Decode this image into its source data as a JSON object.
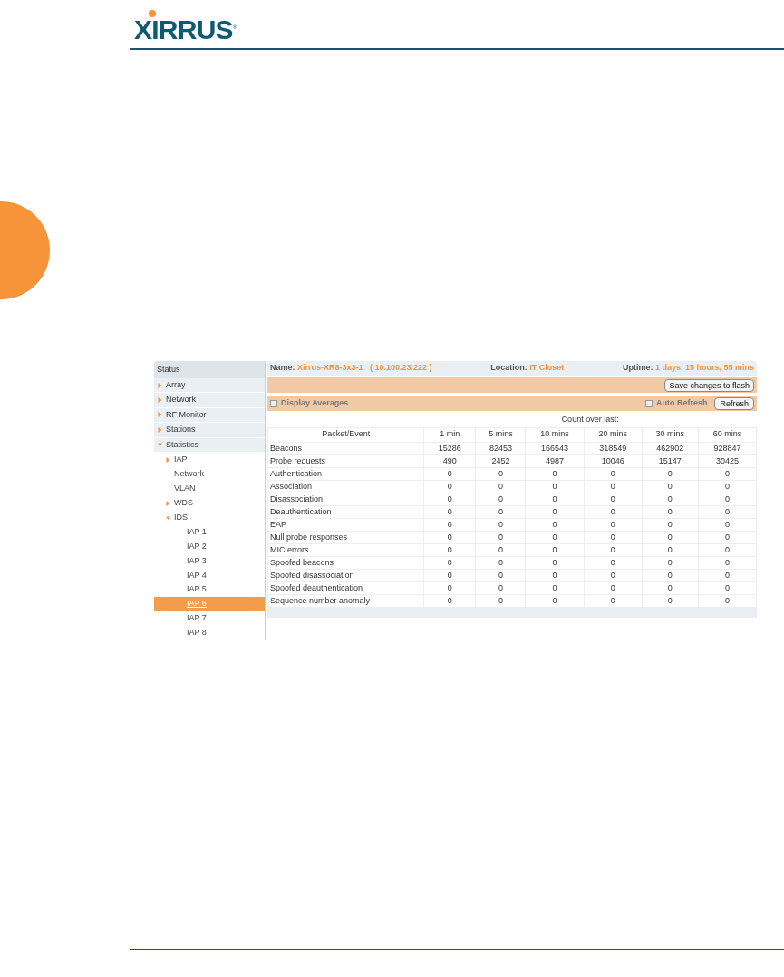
{
  "logo": {
    "text": "XIRRUS",
    "mark": "®"
  },
  "sidebar": {
    "header": "Status",
    "items": [
      {
        "label": "Array",
        "expanded": false,
        "selected": false
      },
      {
        "label": "Network",
        "expanded": false,
        "selected": false
      },
      {
        "label": "RF Monitor",
        "expanded": false,
        "selected": false
      },
      {
        "label": "Stations",
        "expanded": false,
        "selected": false
      },
      {
        "label": "Statistics",
        "expanded": true,
        "selected": false,
        "children": [
          {
            "label": "IAP",
            "expanded": false,
            "selected": false
          },
          {
            "label": "Network",
            "selected": false
          },
          {
            "label": "VLAN",
            "selected": false
          },
          {
            "label": "WDS",
            "expanded": false,
            "selected": false
          },
          {
            "label": "IDS",
            "expanded": true,
            "selected": false,
            "children": [
              {
                "label": "IAP 1",
                "selected": false
              },
              {
                "label": "IAP 2",
                "selected": false
              },
              {
                "label": "IAP 3",
                "selected": false
              },
              {
                "label": "IAP 4",
                "selected": false
              },
              {
                "label": "IAP 5",
                "selected": false
              },
              {
                "label": "IAP 6",
                "selected": true
              },
              {
                "label": "IAP 7",
                "selected": false
              },
              {
                "label": "IAP 8",
                "selected": false
              }
            ]
          }
        ]
      }
    ]
  },
  "info_bar": {
    "name_label": "Name:",
    "name_value": "Xirrus-XR8-3x3-1   ( 10.100.23.222 )",
    "location_label": "Location:",
    "location_value": "IT Closet",
    "uptime_label": "Uptime:",
    "uptime_value": "1 days, 15 hours, 55 mins"
  },
  "save_button": "Save changes to flash",
  "options": {
    "display_averages": {
      "label": "Display Averages",
      "checked": false
    },
    "auto_refresh": {
      "label": "Auto Refresh",
      "checked": false
    },
    "refresh_button": "Refresh"
  },
  "table": {
    "group_header": "Count over last:",
    "columns": [
      "Packet/Event",
      "1 min",
      "5 mins",
      "10 mins",
      "20 mins",
      "30 mins",
      "60 mins"
    ],
    "rows": [
      [
        "Beacons",
        "15286",
        "82453",
        "166543",
        "318549",
        "462902",
        "928847"
      ],
      [
        "Probe requests",
        "490",
        "2452",
        "4987",
        "10046",
        "15147",
        "30425"
      ],
      [
        "Authentication",
        "0",
        "0",
        "0",
        "0",
        "0",
        "0"
      ],
      [
        "Association",
        "0",
        "0",
        "0",
        "0",
        "0",
        "0"
      ],
      [
        "Disassociation",
        "0",
        "0",
        "0",
        "0",
        "0",
        "0"
      ],
      [
        "Deauthentication",
        "0",
        "0",
        "0",
        "0",
        "0",
        "0"
      ],
      [
        "EAP",
        "0",
        "0",
        "0",
        "0",
        "0",
        "0"
      ],
      [
        "Null probe responses",
        "0",
        "0",
        "0",
        "0",
        "0",
        "0"
      ],
      [
        "MIC errors",
        "0",
        "0",
        "0",
        "0",
        "0",
        "0"
      ],
      [
        "Spoofed beacons",
        "0",
        "0",
        "0",
        "0",
        "0",
        "0"
      ],
      [
        "Spoofed disassociation",
        "0",
        "0",
        "0",
        "0",
        "0",
        "0"
      ],
      [
        "Spoofed deauthentication",
        "0",
        "0",
        "0",
        "0",
        "0",
        "0"
      ],
      [
        "Sequence number anomaly",
        "0",
        "0",
        "0",
        "0",
        "0",
        "0"
      ]
    ]
  }
}
